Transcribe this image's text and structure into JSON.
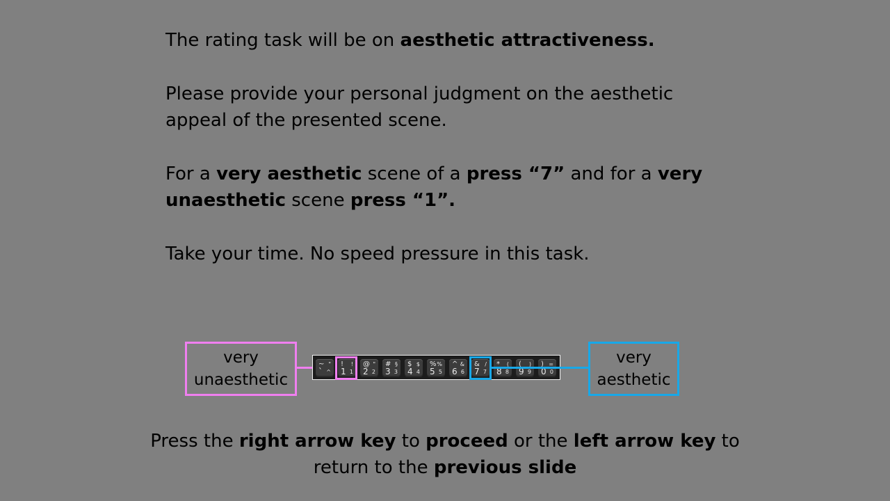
{
  "instructions": {
    "p1": {
      "t1": "The rating task will be on ",
      "b1": "aesthetic attractiveness."
    },
    "p2": {
      "t1": "Please provide your personal judgment on the aesthetic appeal of the presented scene."
    },
    "p3": {
      "t1": "For a ",
      "b1": "very aesthetic",
      "t2": " scene of a ",
      "b2": "press “7”",
      "t3": " and for a ",
      "b3": "very unaesthetic",
      "t4": " scene ",
      "b4": "press “1”."
    },
    "p4": {
      "t1": "Take your time. No speed pressure in this task."
    }
  },
  "scale": {
    "low_label_line1": "very",
    "low_label_line2": "unaesthetic",
    "high_label_line1": "very",
    "high_label_line2": "aesthetic",
    "low_color": "#f07ff0",
    "high_color": "#18a8e8",
    "highlighted_keys": [
      "1",
      "7"
    ],
    "keys": [
      {
        "tl": "~",
        "tr": "\"",
        "bl": "`",
        "br": "^"
      },
      {
        "tl": "!",
        "tr": "!",
        "bl": "1",
        "br": "1"
      },
      {
        "tl": "@",
        "tr": "\"",
        "bl": "2",
        "br": "2"
      },
      {
        "tl": "#",
        "tr": "§",
        "bl": "3",
        "br": "3"
      },
      {
        "tl": "$",
        "tr": "$",
        "bl": "4",
        "br": "4"
      },
      {
        "tl": "%",
        "tr": "%",
        "bl": "5",
        "br": "5"
      },
      {
        "tl": "^",
        "tr": "&",
        "bl": "6",
        "br": "6"
      },
      {
        "tl": "&",
        "tr": "/",
        "bl": "7",
        "br": "7"
      },
      {
        "tl": "*",
        "tr": "(",
        "bl": "8",
        "br": "8"
      },
      {
        "tl": "(",
        "tr": ")",
        "bl": "9",
        "br": "9"
      },
      {
        "tl": ")",
        "tr": "=",
        "bl": "0",
        "br": "0"
      }
    ]
  },
  "footer": {
    "t1": "Press the ",
    "b1": "right arrow key",
    "t2": " to ",
    "b2": "proceed",
    "t3": " or the ",
    "b3": "left arrow key",
    "t4": " to return to the ",
    "b4": "previous slide"
  }
}
